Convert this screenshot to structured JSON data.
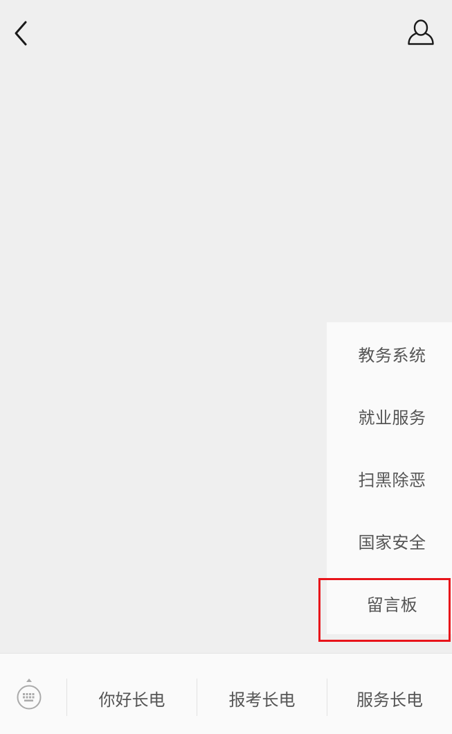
{
  "header": {
    "back_icon": "chevron-left-icon",
    "profile_icon": "user-profile-icon"
  },
  "submenu": {
    "items": [
      {
        "label": "教务系统"
      },
      {
        "label": "就业服务"
      },
      {
        "label": "扫黑除恶"
      },
      {
        "label": "国家安全"
      },
      {
        "label": "留言板",
        "highlighted": true
      }
    ],
    "highlight_color": "#e8141a"
  },
  "bottom_menu": {
    "keyboard_icon": "keyboard-icon",
    "tabs": [
      {
        "label": "你好长电"
      },
      {
        "label": "报考长电"
      },
      {
        "label": "服务长电"
      }
    ]
  },
  "colors": {
    "background": "#efefef",
    "panel": "#fafafa",
    "text": "#555555"
  }
}
